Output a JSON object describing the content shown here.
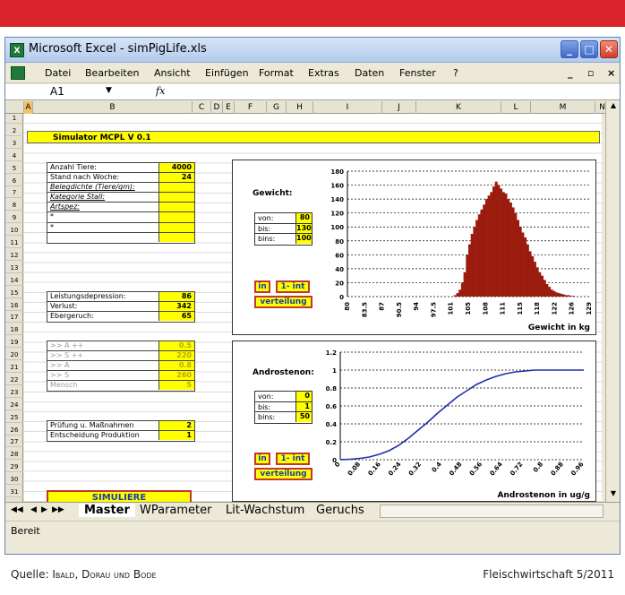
{
  "window": {
    "title": "Microsoft Excel - simPigLife.xls"
  },
  "menu": [
    "Datei",
    "Bearbeiten",
    "Ansicht",
    "Einfügen",
    "Format",
    "Extras",
    "Daten",
    "Fenster",
    "?"
  ],
  "formula_bar": {
    "cell": "A1",
    "fx": "fx"
  },
  "columns": [
    "A",
    "B",
    "C",
    "D",
    "E",
    "F",
    "G",
    "H",
    "I",
    "J",
    "K",
    "L",
    "M",
    "N"
  ],
  "rows": [
    "1",
    "2",
    "3",
    "4",
    "5",
    "6",
    "7",
    "8",
    "9",
    "10",
    "11",
    "12",
    "13",
    "14",
    "15",
    "16",
    "17",
    "18",
    "19",
    "20",
    "21",
    "22",
    "23",
    "24",
    "25",
    "26",
    "27",
    "28",
    "29",
    "30",
    "31"
  ],
  "sim_title": "Simulator MCPL V 0.1",
  "table1": [
    {
      "label": "Anzahl Tiere:",
      "value": "4000"
    },
    {
      "label": "Stand nach Woche:",
      "value": "24"
    },
    {
      "label": "Belegdichte (Tiere/qm):",
      "value": ""
    },
    {
      "label": "Kategorie Stall:",
      "value": ""
    },
    {
      "label": "Artspez:",
      "value": ""
    },
    {
      "label": "*",
      "value": ""
    },
    {
      "label": "*",
      "value": ""
    },
    {
      "label": "",
      "value": ""
    }
  ],
  "table2": [
    {
      "label": "Leistungsdepression:",
      "value": "86"
    },
    {
      "label": "Verlust:",
      "value": "342"
    },
    {
      "label": "Ebergeruch:",
      "value": "65"
    }
  ],
  "table3": [
    {
      "label": ">> A ++",
      "value": "0.5"
    },
    {
      "label": ">> S ++",
      "value": "220"
    },
    {
      "label": ">> A",
      "value": "0.8"
    },
    {
      "label": ">> S",
      "value": "260"
    },
    {
      "label": "Mensch",
      "value": "5"
    }
  ],
  "table4": [
    {
      "label": "Prüfung u. Maßnahmen",
      "value": "2"
    },
    {
      "label": "Entscheidung Produktion",
      "value": "1"
    }
  ],
  "simulate_button": "SIMULIERE",
  "chart1": {
    "title": "Gewicht:",
    "params": [
      {
        "label": "von:",
        "value": "80"
      },
      {
        "label": "bis:",
        "value": "130"
      },
      {
        "label": "bins:",
        "value": "100"
      }
    ],
    "btn_in": "in",
    "btn_int": "1- int",
    "btn_vert": "verteilung",
    "xlabel": "Gewicht in kg"
  },
  "chart2": {
    "title": "Androstenon:",
    "params": [
      {
        "label": "von:",
        "value": "0"
      },
      {
        "label": "bis:",
        "value": "1"
      },
      {
        "label": "bins:",
        "value": "50"
      }
    ],
    "btn_in": "in",
    "btn_int": "1- int",
    "btn_vert": "verteilung",
    "xlabel": "Androstenon in ug/g"
  },
  "chart_data": [
    {
      "type": "bar",
      "ylim": [
        0,
        180
      ],
      "yticks": [
        "0",
        "20",
        "40",
        "60",
        "80",
        "100",
        "120",
        "140",
        "160",
        "180"
      ],
      "xticks": [
        "80",
        "83.5",
        "87",
        "90.5",
        "94",
        "97.5",
        "101",
        "105",
        "108",
        "111",
        "115",
        "118",
        "122",
        "126",
        "129"
      ],
      "grid": true,
      "values": [
        0,
        0,
        0,
        0,
        0,
        0,
        0,
        0,
        0,
        0,
        0,
        0,
        0,
        0,
        0,
        0,
        0,
        0,
        0,
        0,
        0,
        0,
        0,
        0,
        0,
        0,
        0,
        0,
        0,
        0,
        0,
        0,
        0,
        0,
        0,
        0,
        0,
        0,
        0,
        0,
        0,
        0,
        0,
        0,
        2,
        5,
        10,
        20,
        35,
        60,
        75,
        90,
        100,
        110,
        118,
        125,
        132,
        140,
        145,
        150,
        158,
        165,
        160,
        155,
        150,
        148,
        140,
        135,
        128,
        120,
        110,
        100,
        92,
        85,
        75,
        65,
        58,
        50,
        42,
        35,
        30,
        24,
        18,
        14,
        10,
        8,
        6,
        5,
        4,
        3,
        2,
        2,
        1,
        1,
        0,
        0,
        0,
        0,
        0,
        0
      ]
    },
    {
      "type": "line",
      "ylim": [
        0,
        1.2
      ],
      "yticks": [
        "0",
        "0.2",
        "0.4",
        "0.6",
        "0.8",
        "1",
        "1.2"
      ],
      "xticks": [
        "0",
        "0.08",
        "0.16",
        "0.24",
        "0.32",
        "0.4",
        "0.48",
        "0.56",
        "0.64",
        "0.72",
        "0.8",
        "0.88",
        "0.96"
      ],
      "grid": true,
      "x": [
        0,
        0.04,
        0.08,
        0.12,
        0.16,
        0.2,
        0.24,
        0.28,
        0.32,
        0.36,
        0.4,
        0.44,
        0.48,
        0.52,
        0.56,
        0.6,
        0.64,
        0.68,
        0.72,
        0.76,
        0.8,
        0.84,
        0.88,
        0.92,
        0.96,
        1.0
      ],
      "y": [
        0,
        0.005,
        0.015,
        0.03,
        0.06,
        0.1,
        0.16,
        0.24,
        0.33,
        0.42,
        0.52,
        0.61,
        0.7,
        0.77,
        0.84,
        0.89,
        0.93,
        0.96,
        0.98,
        0.99,
        1.0,
        1.0,
        1.0,
        1.0,
        1.0,
        1.0
      ]
    }
  ],
  "sheet_tabs": [
    "Master",
    "WParameter",
    "Lit-Wachstum",
    "Geruchs"
  ],
  "status": "Bereit",
  "caption_left_prefix": "Quelle: ",
  "caption_left_names": "Ibald, Dorau und Bode",
  "caption_right": "Fleischwirtschaft 5/2011"
}
